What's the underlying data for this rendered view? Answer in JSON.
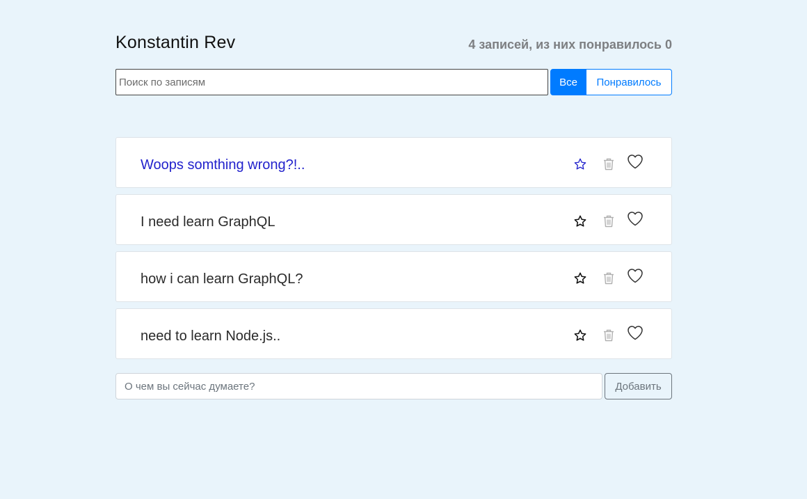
{
  "header": {
    "user_name": "Konstantin Rev",
    "stats": "4 записей, из них понравилось 0"
  },
  "search": {
    "placeholder": "Поиск по записям",
    "value": ""
  },
  "filter": {
    "all_label": "Все",
    "liked_label": "Понравилось",
    "active": "all"
  },
  "posts": [
    {
      "label": "Woops somthing wrong?!..",
      "important": true,
      "liked": false
    },
    {
      "label": "I need learn GraphQL",
      "important": false,
      "liked": false
    },
    {
      "label": "how i can learn GraphQL?",
      "important": false,
      "liked": false
    },
    {
      "label": "need to learn Node.js..",
      "important": false,
      "liked": false
    }
  ],
  "add_form": {
    "placeholder": "О чем вы сейчас думаете?",
    "value": "",
    "button_label": "Добавить"
  },
  "icons": {
    "star": "star-icon",
    "trash": "trash-icon",
    "heart": "heart-icon"
  },
  "colors": {
    "background": "#e9f4fb",
    "primary": "#007bff",
    "important_text": "#2222cc",
    "stats_text": "#7d7f82",
    "trash_icon": "#b0b0b0"
  }
}
